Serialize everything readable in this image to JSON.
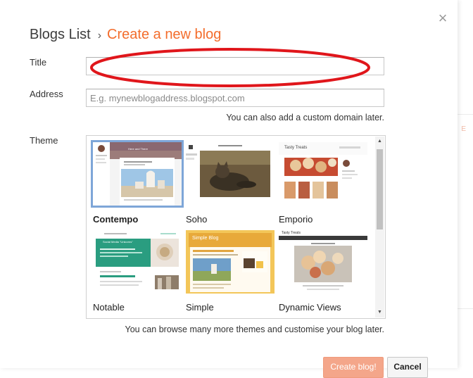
{
  "breadcrumb": {
    "root": "Blogs List",
    "separator": "›",
    "current": "Create a new blog"
  },
  "close_glyph": "×",
  "form": {
    "title_label": "Title",
    "title_value": "",
    "address_label": "Address",
    "address_placeholder": "E.g. mynewblogaddress.blogspot.com",
    "address_hint": "You can also add a custom domain later.",
    "theme_label": "Theme",
    "theme_hint": "You can browse many more themes and customise your blog later."
  },
  "themes": [
    {
      "name": "Contempo",
      "selected": true
    },
    {
      "name": "Soho",
      "selected": false
    },
    {
      "name": "Emporio",
      "selected": false
    },
    {
      "name": "Notable",
      "selected": false
    },
    {
      "name": "Simple",
      "selected": false
    },
    {
      "name": "Dynamic Views",
      "selected": false
    }
  ],
  "thumb_text": {
    "contempo_header": "Here and There",
    "emporio_header": "Tasty Treats",
    "notable_post": "Social Media \"Unicorns\"",
    "simple_header": "Simple Blog",
    "dynamic_header": "Tasty Treats"
  },
  "buttons": {
    "create": "Create blog!",
    "cancel": "Cancel"
  },
  "colors": {
    "accent": "#f36d2c",
    "annotation": "#e0161b",
    "selection": "#7ea6d8",
    "notable_green": "#2a9d80"
  },
  "icons": {
    "close": "close-icon",
    "chevron": "chevron-right-icon"
  }
}
